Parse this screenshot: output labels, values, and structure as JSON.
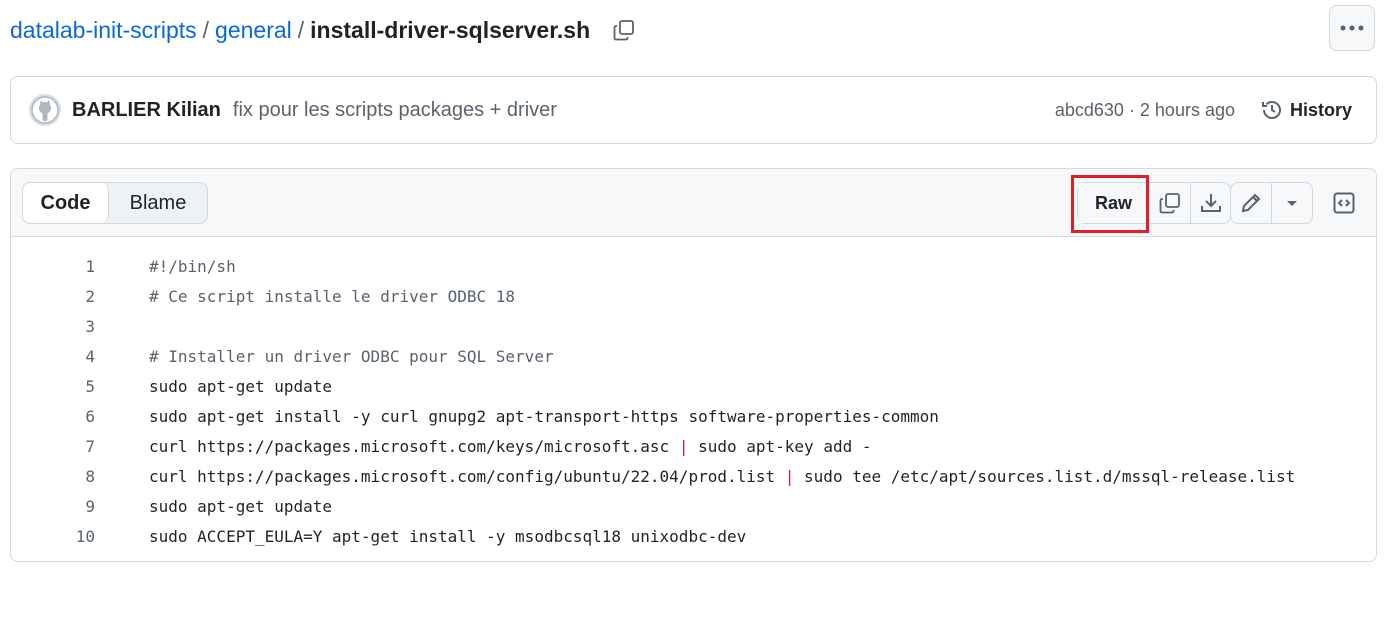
{
  "breadcrumb": {
    "repo": "datalab-init-scripts",
    "separator": "/",
    "folder": "general",
    "file": "install-driver-sqlserver.sh"
  },
  "icons": {
    "copy_path": "copy-icon",
    "more": "kebab-horizontal-icon",
    "avatar": "github-mark-icon",
    "history": "history-icon",
    "copy": "copy-icon",
    "download": "download-icon",
    "edit": "pencil-icon",
    "dropdown": "triangle-down-icon",
    "symbols": "code-square-icon"
  },
  "commit": {
    "author": "BARLIER Kilian",
    "message": "fix pour les scripts packages + driver",
    "meta": "abcd630 · 2 hours ago",
    "history_label": "History"
  },
  "file_header": {
    "tab_code": "Code",
    "tab_blame": "Blame",
    "raw_label": "Raw"
  },
  "colors": {
    "link": "#0969da",
    "highlight": "#e11d2a",
    "pipe": "#cf222e"
  },
  "code": {
    "lines": [
      {
        "num": "1",
        "text": "#!/bin/sh"
      },
      {
        "num": "2",
        "text": "# Ce script installe le driver ODBC 18"
      },
      {
        "num": "3",
        "text": ""
      },
      {
        "num": "4",
        "text": "# Installer un driver ODBC pour SQL Server"
      },
      {
        "num": "5",
        "text": "sudo apt-get update"
      },
      {
        "num": "6",
        "text": "sudo apt-get install -y curl gnupg2 apt-transport-https software-properties-common"
      },
      {
        "num": "7",
        "before": "curl https://packages.microsoft.com/keys/microsoft.asc ",
        "pipe": "|",
        "after": " sudo apt-key add -"
      },
      {
        "num": "8",
        "before": "curl https://packages.microsoft.com/config/ubuntu/22.04/prod.list ",
        "pipe": "|",
        "after": " sudo tee /etc/apt/sources.list.d/mssql-release.list"
      },
      {
        "num": "9",
        "text": "sudo apt-get update"
      },
      {
        "num": "10",
        "text": "sudo ACCEPT_EULA=Y apt-get install -y msodbcsql18 unixodbc-dev"
      }
    ]
  }
}
